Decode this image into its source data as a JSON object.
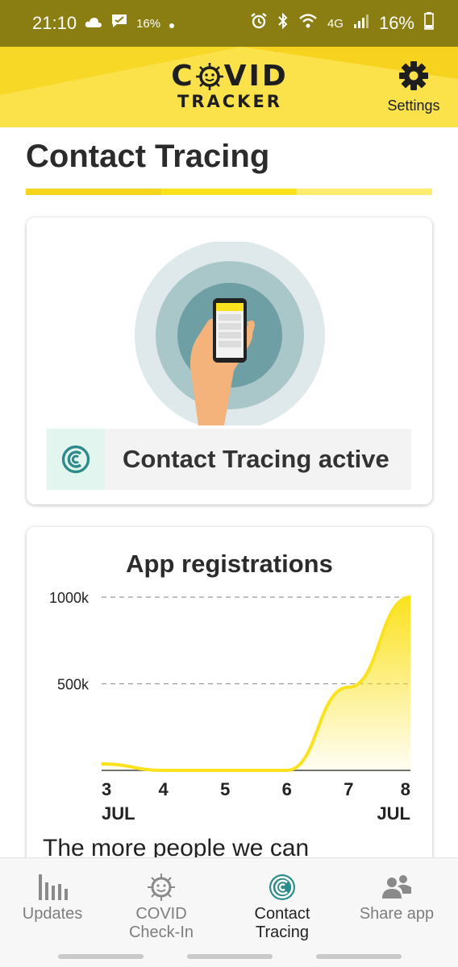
{
  "status_bar": {
    "time": "21:10",
    "notif_percent": "16",
    "battery": "16%",
    "network": "4G"
  },
  "header": {
    "logo_line1": "COVID",
    "logo_line2": "TRACKER",
    "settings_label": "Settings",
    "brand_yellow": "#fbe24a"
  },
  "page": {
    "title": "Contact Tracing"
  },
  "status_card": {
    "status_text": "Contact Tracing active",
    "status_icon": "contact-tracing-icon",
    "accent_color": "#2e8b8b"
  },
  "chart_card": {
    "title": "App registrations",
    "footer_text": "The more people we can"
  },
  "chart_data": {
    "type": "area",
    "title": "App registrations",
    "x": [
      3,
      4,
      5,
      6,
      7,
      8
    ],
    "tick_labels": [
      "3",
      "4",
      "5",
      "6",
      "7",
      "8"
    ],
    "tick_sublabels": [
      "JUL",
      "",
      "",
      "",
      "",
      "JUL"
    ],
    "y_ticks": [
      {
        "value": 500000,
        "label": "500k"
      },
      {
        "value": 1000000,
        "label": "1000k"
      }
    ],
    "values": [
      0,
      0,
      0,
      0,
      480000,
      1000000
    ],
    "ylim": [
      0,
      1000000
    ],
    "xlim": [
      3,
      8
    ],
    "grid": "dashed horizontal",
    "series_color": "#fbe21e"
  },
  "bottom_nav": {
    "items": [
      {
        "label": "Updates",
        "icon": "bar-chart-icon",
        "active": false
      },
      {
        "label": "COVID\nCheck-In",
        "label_line1": "COVID",
        "label_line2": "Check-In",
        "icon": "virus-icon",
        "active": false
      },
      {
        "label_line1": "Contact",
        "label_line2": "Tracing",
        "icon": "contact-tracing-icon",
        "active": true
      },
      {
        "label": "Share app",
        "icon": "people-icon",
        "active": false
      }
    ]
  }
}
